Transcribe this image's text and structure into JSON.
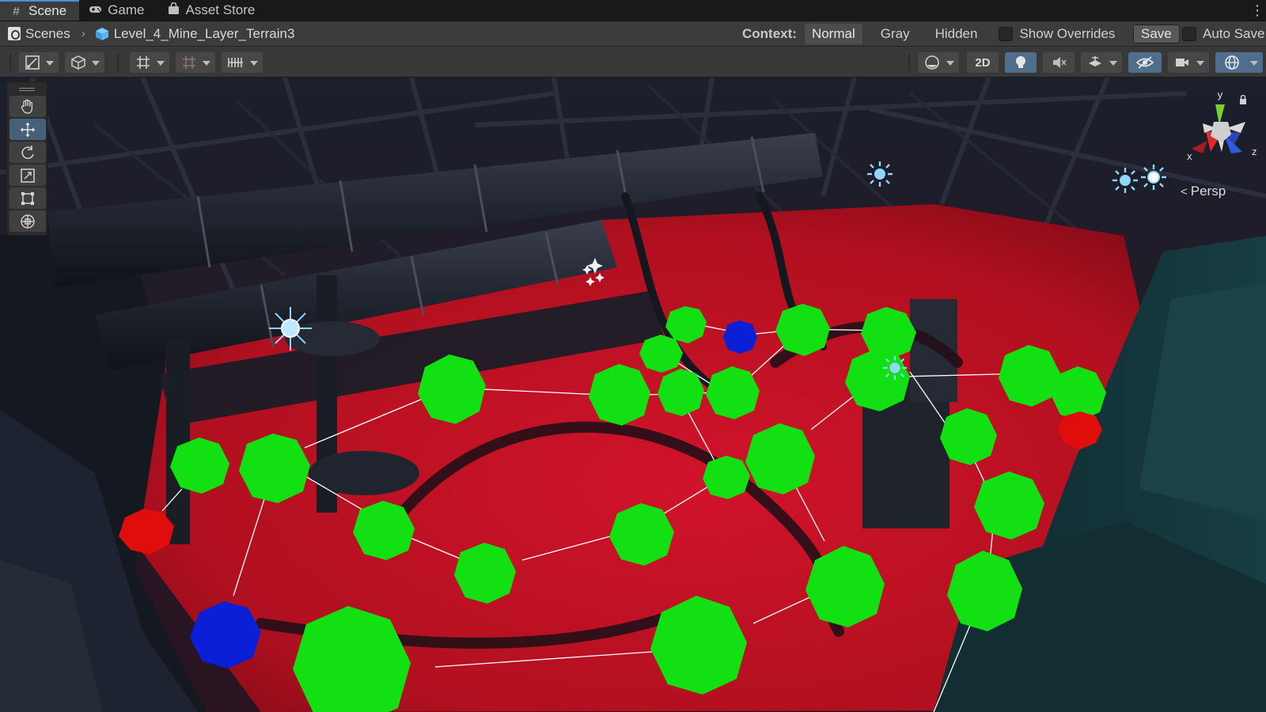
{
  "tabs": [
    {
      "label": "Scene",
      "icon": "hash-icon",
      "active": true
    },
    {
      "label": "Game",
      "icon": "gamepad-icon",
      "active": false
    },
    {
      "label": "Asset Store",
      "icon": "shopping-bag-icon",
      "active": false
    }
  ],
  "breadcrumb": {
    "root": "Scenes",
    "prefab": "Level_4_Mine_Layer_Terrain3"
  },
  "context": {
    "label": "Context:",
    "modes": [
      "Normal",
      "Gray",
      "Hidden"
    ],
    "selected": "Normal"
  },
  "overrides": {
    "show_overrides_label": "Show Overrides",
    "save_label": "Save",
    "auto_save_label": "Auto Save"
  },
  "toolbar": {
    "two_d_label": "2D"
  },
  "tools": [
    "hand-tool",
    "move-tool",
    "rotate-tool",
    "scale-tool",
    "rect-tool",
    "transform-tool"
  ],
  "active_tool": "move-tool",
  "gizmo": {
    "x_label": "x",
    "y_label": "y",
    "z_label": "z",
    "projection_label": "Persp"
  },
  "colors": {
    "node_green": "#12e012",
    "node_red": "#e00d0d",
    "node_blue": "#0a1fd6",
    "floor_red": "#c00f22",
    "link_white": "#ffffff",
    "light_icon": "#8ed8ff"
  }
}
